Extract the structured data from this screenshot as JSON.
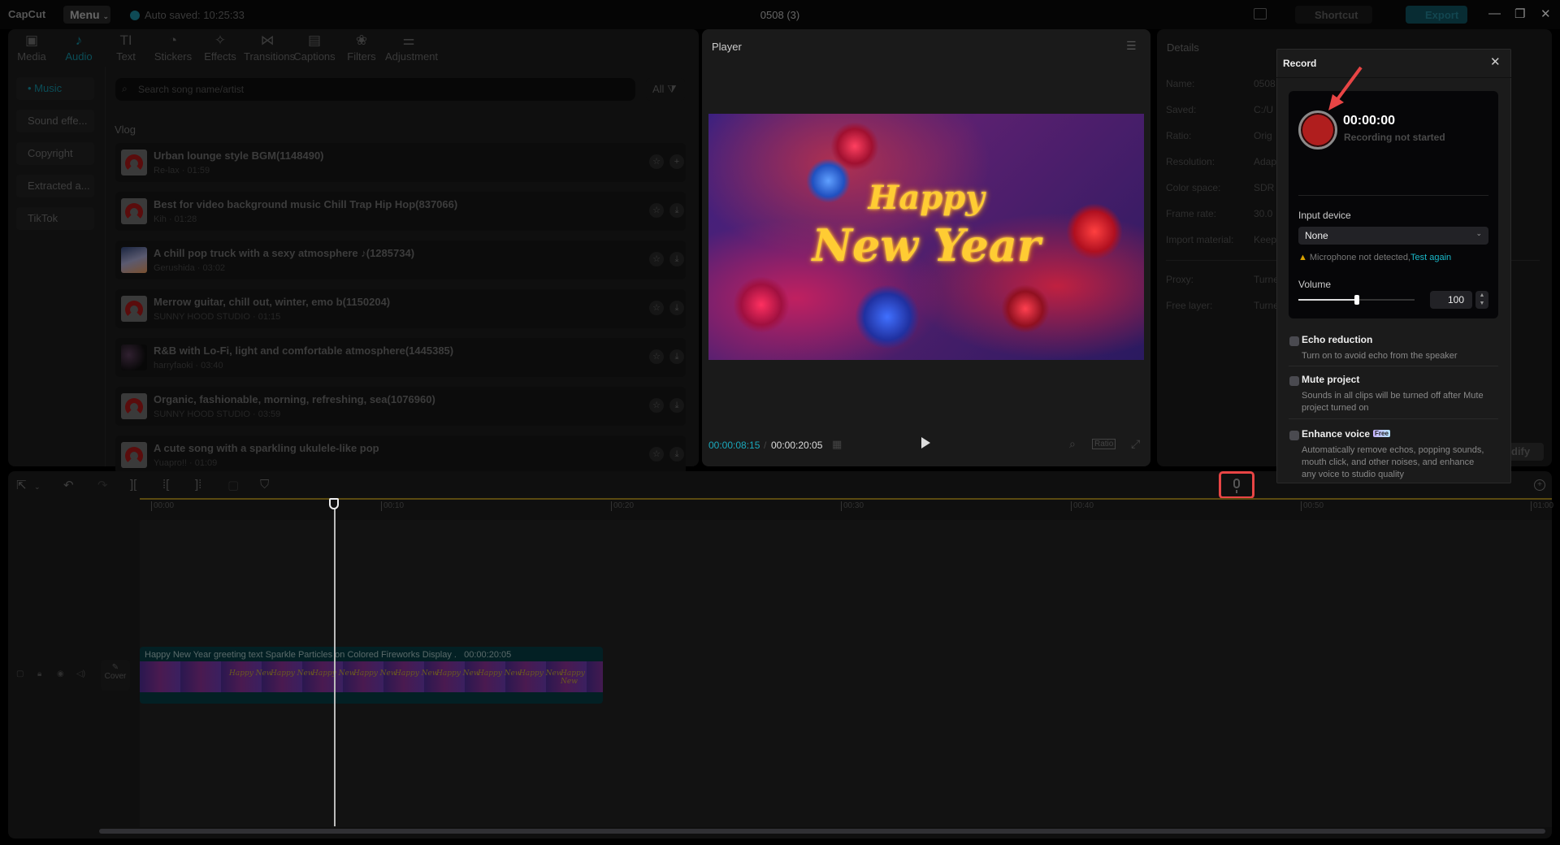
{
  "app": {
    "logo": "CapCut",
    "menu_label": "Menu",
    "autosave": "Auto saved: 10:25:33",
    "project_title": "0508 (3)",
    "shortcut_label": "Shortcut",
    "export_label": "Export",
    "window_controls": {
      "minimize": "—",
      "maximize": "❐",
      "close": "✕"
    }
  },
  "tool_tabs": [
    {
      "label": "Media",
      "icon": "media-icon",
      "glyph": "▣",
      "active": false
    },
    {
      "label": "Audio",
      "icon": "audio-icon",
      "glyph": "♪",
      "active": true
    },
    {
      "label": "Text",
      "icon": "text-icon",
      "glyph": "TI",
      "active": false
    },
    {
      "label": "Stickers",
      "icon": "stickers-icon",
      "glyph": "◔",
      "active": false
    },
    {
      "label": "Effects",
      "icon": "effects-icon",
      "glyph": "✧",
      "active": false
    },
    {
      "label": "Transitions",
      "icon": "transitions-icon",
      "glyph": "⋈",
      "active": false
    },
    {
      "label": "Captions",
      "icon": "captions-icon",
      "glyph": "▤",
      "active": false
    },
    {
      "label": "Filters",
      "icon": "filters-icon",
      "glyph": "❀",
      "active": false
    },
    {
      "label": "Adjustment",
      "icon": "adjustment-icon",
      "glyph": "⚌",
      "active": false
    }
  ],
  "audio_categories": [
    {
      "label": "• Music",
      "active": true
    },
    {
      "label": "Sound effe...",
      "active": false
    },
    {
      "label": "Copyright",
      "active": false
    },
    {
      "label": "Extracted a...",
      "active": false
    },
    {
      "label": "TikTok",
      "active": false
    }
  ],
  "search": {
    "placeholder": "Search song name/artist",
    "filter_label": "All"
  },
  "section_title": "Vlog",
  "songs": [
    {
      "title": "Urban lounge style BGM(1148490)",
      "artist": "Re-lax",
      "duration": "01:59",
      "thumb": "disc",
      "action": "add"
    },
    {
      "title": "Best for video background music Chill Trap Hip Hop(837066)",
      "artist": "Kih",
      "duration": "01:28",
      "thumb": "disc",
      "action": "download"
    },
    {
      "title": "A chill pop truck with a sexy atmosphere ♪(1285734)",
      "artist": "Gerushida",
      "duration": "03:02",
      "thumb": "photo",
      "action": "download"
    },
    {
      "title": "Merrow guitar, chill out, winter, emo b(1150204)",
      "artist": "SUNNY HOOD STUDIO",
      "duration": "01:15",
      "thumb": "disc",
      "action": "download"
    },
    {
      "title": "R&B with Lo-Fi, light and comfortable atmosphere(1445385)",
      "artist": "harryfaoki",
      "duration": "03:40",
      "thumb": "photo2",
      "action": "download"
    },
    {
      "title": "Organic, fashionable, morning, refreshing, sea(1076960)",
      "artist": "SUNNY HOOD STUDIO",
      "duration": "03:59",
      "thumb": "disc",
      "action": "download"
    },
    {
      "title": "A cute song with a sparkling ukulele-like pop",
      "artist": "Yuapro!!",
      "duration": "01:09",
      "thumb": "disc",
      "action": "download"
    }
  ],
  "player": {
    "title": "Player",
    "video_text_line1": "Happy",
    "video_text_line2": "New Year",
    "current_time": "00:00:08:15",
    "total_time": "00:00:20:05",
    "ratio_label": "Ratio"
  },
  "details": {
    "title": "Details",
    "rows": [
      {
        "label": "Name:",
        "value": "0508"
      },
      {
        "label": "Saved:",
        "value": "C:/U"
      },
      {
        "label": "Ratio:",
        "value": "Orig"
      },
      {
        "label": "Resolution:",
        "value": "Adap"
      },
      {
        "label": "Color space:",
        "value": "SDR"
      },
      {
        "label": "Frame rate:",
        "value": "30.0"
      },
      {
        "label": "Import material:",
        "value": "Keep"
      },
      {
        "label": "Proxy:",
        "value": "Turne"
      },
      {
        "label": "Free layer:",
        "value": "Turne"
      }
    ],
    "modify_label": "dify"
  },
  "timeline": {
    "ruler": [
      "00:00",
      "00:10",
      "00:20",
      "00:30",
      "00:40",
      "00:50",
      "01:00"
    ],
    "playhead_time": "00:00:08:15",
    "clip": {
      "title": "Happy New Year greeting text Sparkle Particles on Colored Fireworks Display .",
      "duration": "00:00:20:05"
    },
    "cover_label": "Cover"
  },
  "record": {
    "title": "Record",
    "time": "00:00:00",
    "status": "Recording not started",
    "input_device_label": "Input device",
    "input_device_value": "None",
    "mic_warning": "Microphone not detected,",
    "test_again": "Test again",
    "volume_label": "Volume",
    "volume_value": "100",
    "volume_fraction": 0.5,
    "options": [
      {
        "title": "Echo reduction",
        "desc": "Turn on to avoid echo from the speaker",
        "checked": false,
        "badge": ""
      },
      {
        "title": "Mute project",
        "desc": "Sounds in all clips will be turned off after Mute project turned on",
        "checked": false,
        "badge": ""
      },
      {
        "title": "Enhance voice",
        "desc": "Automatically remove echos, popping sounds, mouth click, and other noises, and enhance any voice to studio quality",
        "checked": false,
        "badge": "Free"
      }
    ]
  },
  "colors": {
    "accent": "#1aa9bd",
    "record_red": "#b01e1e",
    "highlight_red": "#e84545",
    "warning": "#d9a100"
  }
}
